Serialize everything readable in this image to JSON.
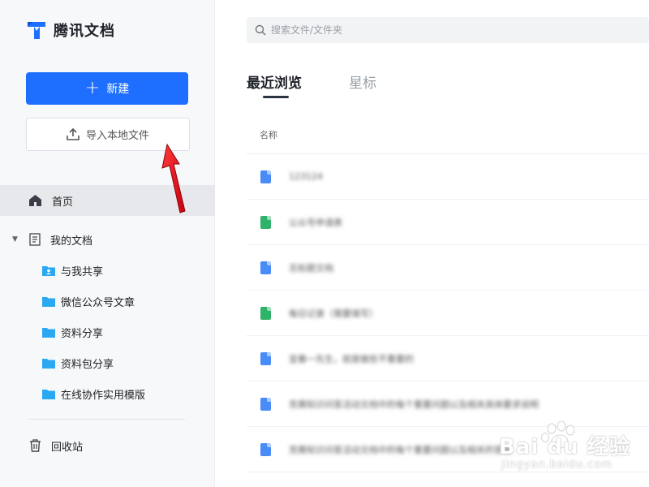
{
  "app": {
    "logo_text": "腾讯文档"
  },
  "sidebar": {
    "new_button_label": "新建",
    "import_button_label": "导入本地文件",
    "home_label": "首页",
    "mydocs_label": "我的文档",
    "folders": [
      {
        "label": "与我共享",
        "icon": "shared-folder-icon"
      },
      {
        "label": "微信公众号文章",
        "icon": "folder-icon"
      },
      {
        "label": "资料分享",
        "icon": "folder-icon"
      },
      {
        "label": "资料包分享",
        "icon": "folder-icon"
      },
      {
        "label": "在线协作实用模版",
        "icon": "folder-icon"
      }
    ],
    "trash_label": "回收站"
  },
  "search": {
    "placeholder": "搜索文件/文件夹"
  },
  "tabs": [
    {
      "label": "最近浏览",
      "active": true
    },
    {
      "label": "星标",
      "active": false
    }
  ],
  "table": {
    "column_name_header": "名称",
    "rows": [
      {
        "name": "123124",
        "type": "doc",
        "color": "#4a8cf7"
      },
      {
        "name": "公众号申请表",
        "type": "sheet",
        "color": "#2fb26a"
      },
      {
        "name": "无标题文档",
        "type": "doc",
        "color": "#4a8cf7"
      },
      {
        "name": "每日记录（需要填写）",
        "type": "sheet",
        "color": "#2fb26a"
      },
      {
        "name": "宜春一先生，就是做些不重要的",
        "type": "doc",
        "color": "#4a8cf7"
      },
      {
        "name": "竞赛知识问答活动文档中的每个重要问题以及相关具体要求说明",
        "type": "doc",
        "color": "#4a8cf7"
      },
      {
        "name": "竞赛知识问答活动文档中的每个重要问题以及相关的答案",
        "type": "doc",
        "color": "#4a8cf7"
      }
    ]
  },
  "watermark": {
    "text": "Bai du 经验",
    "sub": "jingyan.baidu.com"
  },
  "colors": {
    "accent": "#1e6fff",
    "folder": "#2aa8f2",
    "annotation_arrow": "#e8141b"
  }
}
